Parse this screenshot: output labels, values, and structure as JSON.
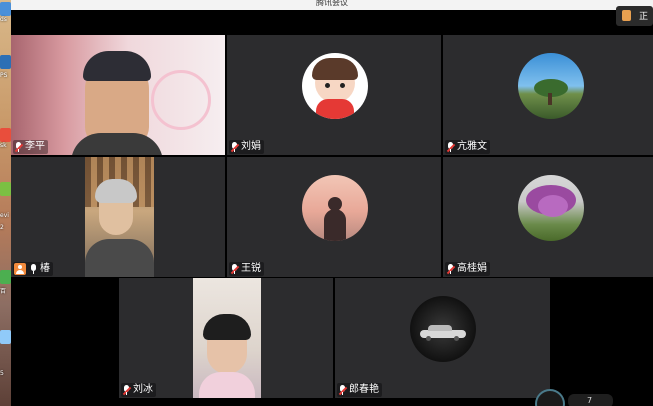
{
  "window": {
    "title": "腾讯会议"
  },
  "top_right": {
    "label": "正"
  },
  "desktop": {
    "labels": [
      "ds",
      "PS",
      "sk",
      "evi",
      "2",
      "百",
      "5"
    ]
  },
  "participants": [
    {
      "name": "李平",
      "kind": "video",
      "muted": true
    },
    {
      "name": "刘娟",
      "kind": "avatar",
      "avatar": "cartoon-girl",
      "muted": true
    },
    {
      "name": "亢雅文",
      "kind": "avatar",
      "avatar": "tree-landscape",
      "muted": true
    },
    {
      "name": "椿",
      "kind": "video",
      "muted": false,
      "host_badge": true
    },
    {
      "name": "王锐",
      "kind": "avatar",
      "avatar": "sunset-silhouette",
      "muted": true
    },
    {
      "name": "高桂娟",
      "kind": "avatar",
      "avatar": "purple-blossom-tree",
      "muted": true
    },
    {
      "name": "刘冰",
      "kind": "video",
      "muted": true
    },
    {
      "name": "郎春艳",
      "kind": "avatar",
      "avatar": "car-dark",
      "muted": true
    }
  ],
  "status": {
    "network": "7"
  },
  "colors": {
    "tile_bg": "#2c2c2e",
    "grid_bg": "#000000",
    "mute_red": "#e53935"
  }
}
